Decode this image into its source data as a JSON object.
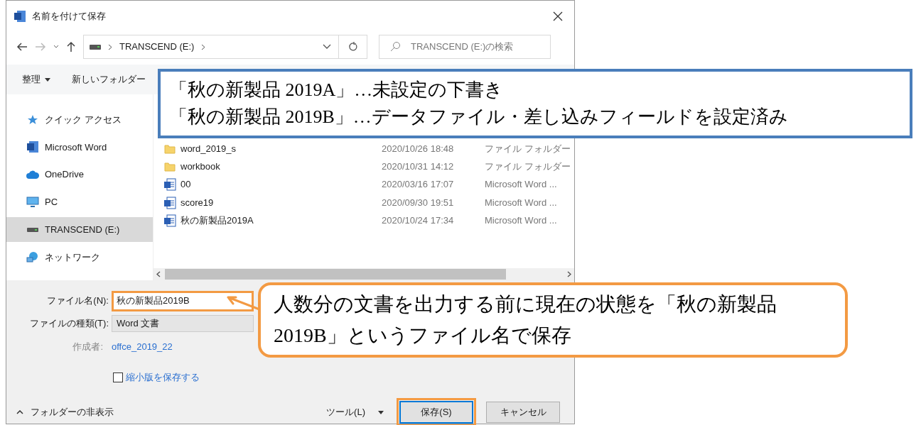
{
  "window": {
    "title": "名前を付けて保存"
  },
  "address": {
    "path": "TRANSCEND (E:)",
    "search_placeholder": "TRANSCEND (E:)の検索"
  },
  "toolbar": {
    "organize": "整理",
    "new_folder": "新しいフォルダー"
  },
  "sidebar": {
    "items": [
      {
        "kind": "quick",
        "label": "クイック アクセス",
        "selected": false
      },
      {
        "kind": "word",
        "label": "Microsoft Word",
        "selected": false
      },
      {
        "kind": "cloud",
        "label": "OneDrive",
        "selected": false
      },
      {
        "kind": "pc",
        "label": "PC",
        "selected": false
      },
      {
        "kind": "drive",
        "label": "TRANSCEND (E:)",
        "selected": true
      },
      {
        "kind": "network",
        "label": "ネットワーク",
        "selected": false
      }
    ]
  },
  "files": [
    {
      "kind": "folder",
      "name": "word_2019_s",
      "date": "2020/10/26 18:48",
      "type": "ファイル フォルダー"
    },
    {
      "kind": "folder",
      "name": "workbook",
      "date": "2020/10/31 14:12",
      "type": "ファイル フォルダー"
    },
    {
      "kind": "document",
      "name": "00",
      "date": "2020/03/16 17:07",
      "type": "Microsoft Word ..."
    },
    {
      "kind": "document",
      "name": "score19",
      "date": "2020/09/30 19:51",
      "type": "Microsoft Word ..."
    },
    {
      "kind": "document",
      "name": "秋の新製品2019A",
      "date": "2020/10/24 17:34",
      "type": "Microsoft Word ..."
    }
  ],
  "form": {
    "filename_label": "ファイル名(N):",
    "filename": "秋の新製品2019B",
    "filetype_label": "ファイルの種類(T):",
    "filetype": "Word 文書",
    "author_label": "作成者:",
    "author": "offce_2019_22",
    "thumbnail_label": "縮小版を保存する",
    "thumbnail_checked": false
  },
  "footer": {
    "hide_folders": "フォルダーの非表示",
    "tools": "ツール(L)",
    "save": "保存(S)",
    "cancel": "キャンセル"
  },
  "annotations": {
    "note_lines": [
      "「秋の新製品 2019A」…未設定の下書き",
      "「秋の新製品 2019B」…データファイル・差し込みフィールドを設定済み"
    ],
    "callout": "人数分の文書を出力する前に現在の状態を「秋の新製品 2019B」というファイル名で保存"
  }
}
